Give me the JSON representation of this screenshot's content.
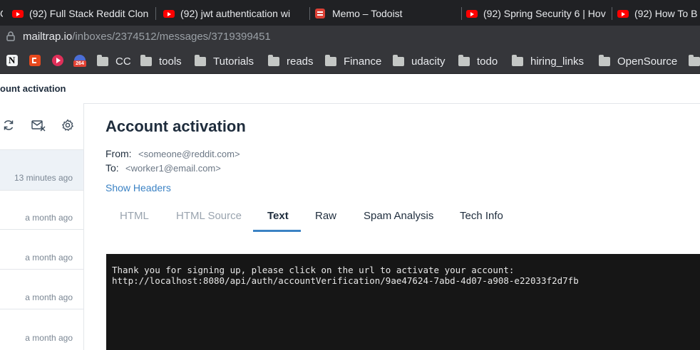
{
  "browser": {
    "tabs": [
      {
        "title": "(92) Full Stack Reddit Clon",
        "icon": "youtube-icon"
      },
      {
        "title": "(92) jwt authentication wi",
        "icon": "youtube-icon"
      },
      {
        "title": "Memo – Todoist",
        "icon": "todoist-icon"
      },
      {
        "title": "(92) Spring Security 6 | Hov",
        "icon": "youtube-icon"
      },
      {
        "title": "(92) How To B",
        "icon": "youtube-icon"
      }
    ],
    "url_host": "mailtrap.io",
    "url_path": "/inboxes/2374512/messages/3719399451",
    "bookmarks": [
      "CC",
      "tools",
      "Tutorials",
      "reads",
      "Finance",
      "udacity",
      "todo",
      "hiring_links",
      "OpenSource"
    ],
    "badge_number": "264"
  },
  "header": {
    "breadcrumb": "ount activation"
  },
  "sidebar": {
    "messages": [
      {
        "time": "13 minutes ago"
      },
      {
        "time": "a month ago"
      },
      {
        "time": "a month ago"
      },
      {
        "time": "a month ago"
      },
      {
        "time": "a month ago"
      }
    ]
  },
  "message": {
    "subject": "Account activation",
    "from_label": "From:",
    "from_value": "<someone@reddit.com>",
    "to_label": "To:",
    "to_value": "<worker1@email.com>",
    "show_headers": "Show Headers",
    "tabs": [
      "HTML",
      "HTML Source",
      "Text",
      "Raw",
      "Spam Analysis",
      "Tech Info"
    ],
    "active_tab": "Text",
    "text_line1": "Thank you for signing up, please click on the url to activate your account:",
    "text_line2": "http://localhost:8080/api/auth/accountVerification/9ae47624-7abd-4d07-a908-e22033f2d7fb"
  },
  "colors": {
    "accent": "#3b82c4",
    "text_panel_bg": "#161616"
  }
}
